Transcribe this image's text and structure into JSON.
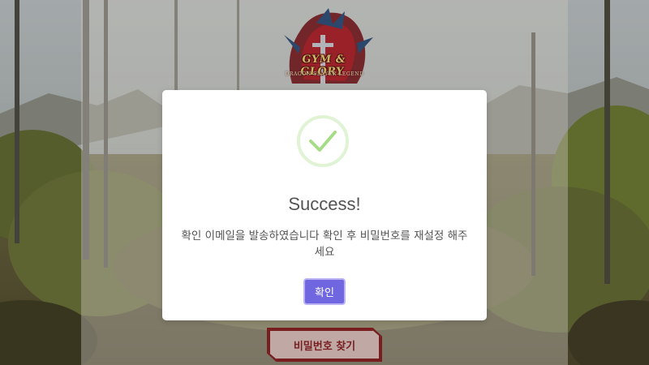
{
  "logo": {
    "title": "GYM & GLORY",
    "subtitle": "DRAGON SLAYER LEGEND"
  },
  "background_button": {
    "label": "비밀번호 찾기"
  },
  "modal": {
    "icon": "check-icon",
    "title": "Success!",
    "message": "확인 이메일을 발송하였습니다 확인 후 비밀번호를 재설정 해주세요",
    "confirm_label": "확인"
  },
  "colors": {
    "confirm_button": "#7066e0",
    "success_icon": "#a5dc86",
    "find_button_border": "#8a1b1f"
  }
}
